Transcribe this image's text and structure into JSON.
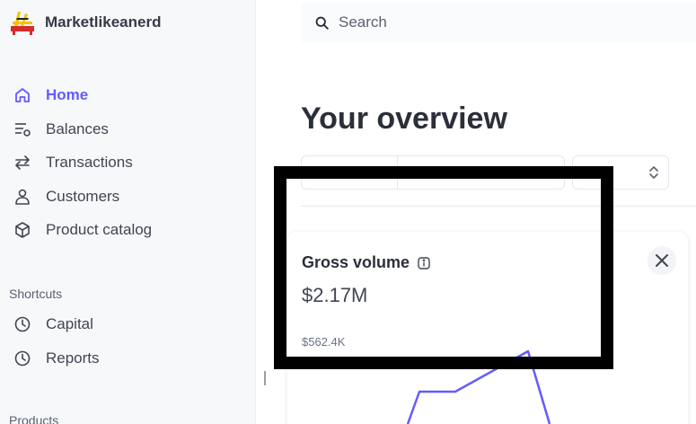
{
  "brand": {
    "name": "Marketlikeanerd"
  },
  "sidebar": {
    "items": [
      {
        "label": "Home",
        "icon": "home-icon",
        "active": true
      },
      {
        "label": "Balances",
        "icon": "balances-icon"
      },
      {
        "label": "Transactions",
        "icon": "transactions-icon"
      },
      {
        "label": "Customers",
        "icon": "customers-icon"
      },
      {
        "label": "Product catalog",
        "icon": "product-catalog-icon"
      }
    ],
    "shortcuts_label": "Shortcuts",
    "shortcuts": [
      {
        "label": "Capital",
        "icon": "clock-icon"
      },
      {
        "label": "Reports",
        "icon": "clock-icon"
      }
    ],
    "products_label": "Products"
  },
  "search": {
    "placeholder": "Search"
  },
  "main": {
    "title": "Your overview",
    "card": {
      "title": "Gross volume",
      "value": "$2.17M",
      "axis_label": "$562.4K"
    }
  },
  "colors": {
    "accent": "#635bff",
    "chart_line": "#635bff",
    "sidebar_bg": "#f6f8fa"
  }
}
